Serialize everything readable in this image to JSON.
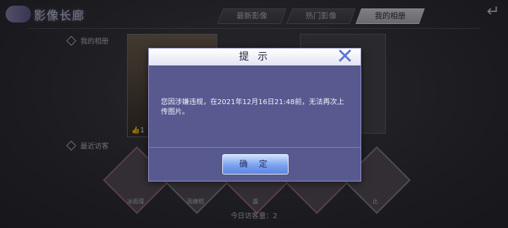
{
  "header": {
    "title": "影像长廊"
  },
  "tabs": [
    {
      "label": "最新影像",
      "active": false
    },
    {
      "label": "热门影像",
      "active": false
    },
    {
      "label": "我的相册",
      "active": true
    }
  ],
  "sections": {
    "my_album": "我的相册",
    "recent_visitors": "最近访客"
  },
  "album": {
    "likes": "1"
  },
  "visitors": [
    {
      "name": "冰雨瑾"
    },
    {
      "name": "雨婕相"
    },
    {
      "name": "露"
    },
    {
      "name": ""
    },
    {
      "name": "比"
    }
  ],
  "footer": {
    "visits_today": "今日访客量：2"
  },
  "dialog": {
    "title": "提 示",
    "message": "您因涉嫌违规，在2021年12月16日21:48前，无法再次上传图片。",
    "confirm_label": "确 定"
  },
  "colors": {
    "dialog_bg": "#58598f",
    "header_bg": "#ffffff",
    "confirm_bg": "#7aa2ef",
    "close_icon": "#5d78c9"
  }
}
